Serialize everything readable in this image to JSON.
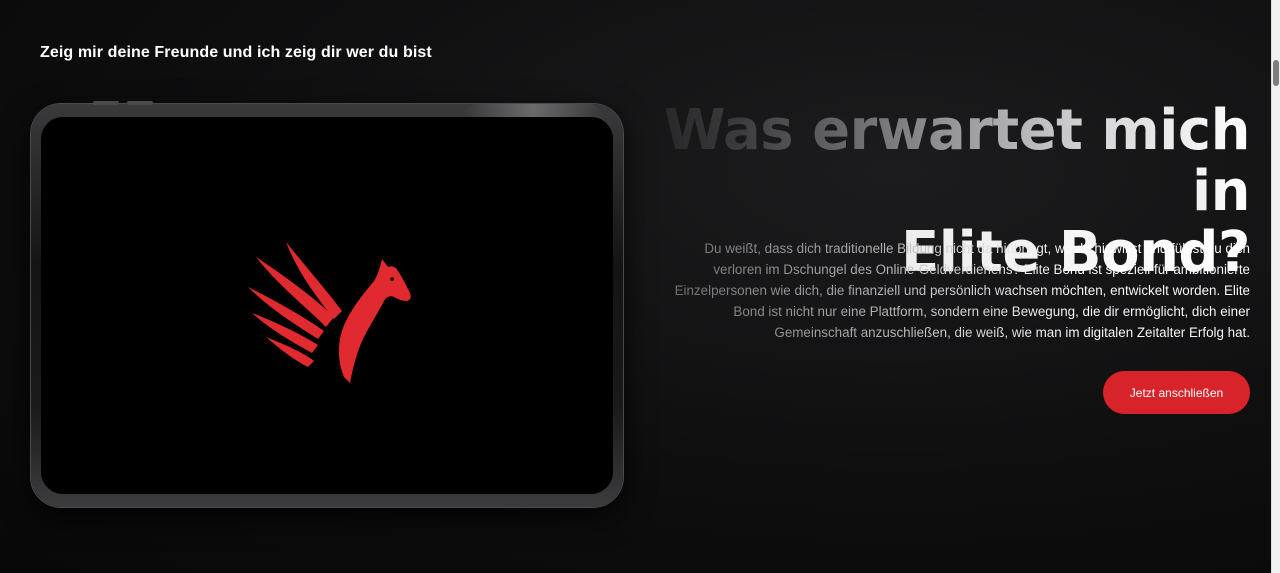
{
  "tagline": "Zeig mir deine Freunde und ich zeig dir wer du bist",
  "headline": {
    "line1": "Was erwartet mich in",
    "line2": "Elite Bond?"
  },
  "description": "Du weißt, dass dich traditionelle Bildung nicht da hinbringt, wo du hinwillst und fühlst du dich verloren im Dschungel des Online-Geldverdienens? Elite Bond ist speziell für ambitionierte Einzelpersonen wie dich, die finanziell und persönlich wachsen möchten, entwickelt worden. Elite Bond ist nicht nur eine Plattform, sondern eine Bewegung, die dir ermöglicht, dich einer Gemeinschaft anzuschließen, die weiß, wie man im digitalen Zeitalter Erfolg hat.",
  "cta": {
    "label": "Jetzt anschließen"
  },
  "logo": {
    "icon": "pegasus-icon",
    "color": "#e02a2f"
  },
  "colors": {
    "accent": "#d8232a",
    "background": "#0b0b0c"
  }
}
